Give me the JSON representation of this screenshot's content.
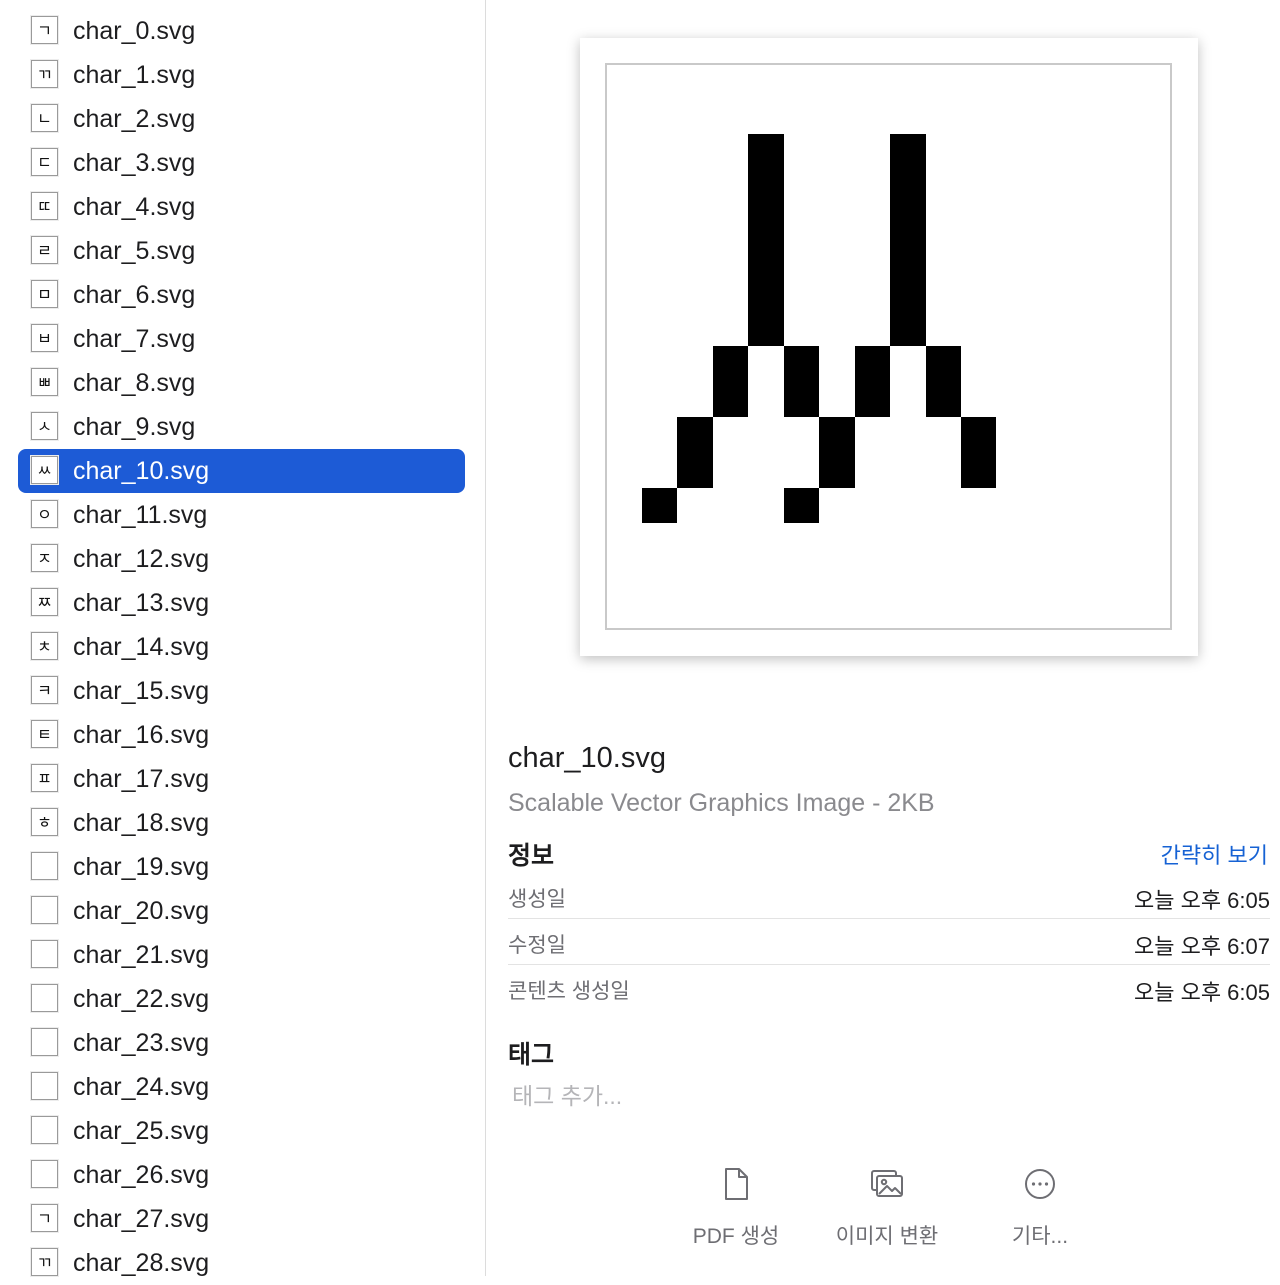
{
  "file_list": [
    {
      "name": "char_0.svg",
      "glyph": "ㄱ"
    },
    {
      "name": "char_1.svg",
      "glyph": "ㄲ"
    },
    {
      "name": "char_2.svg",
      "glyph": "ㄴ"
    },
    {
      "name": "char_3.svg",
      "glyph": "ㄷ"
    },
    {
      "name": "char_4.svg",
      "glyph": "ㄸ"
    },
    {
      "name": "char_5.svg",
      "glyph": "ㄹ"
    },
    {
      "name": "char_6.svg",
      "glyph": "ㅁ"
    },
    {
      "name": "char_7.svg",
      "glyph": "ㅂ"
    },
    {
      "name": "char_8.svg",
      "glyph": "ㅃ"
    },
    {
      "name": "char_9.svg",
      "glyph": "ㅅ"
    },
    {
      "name": "char_10.svg",
      "glyph": "ㅆ",
      "selected": true
    },
    {
      "name": "char_11.svg",
      "glyph": "ㅇ"
    },
    {
      "name": "char_12.svg",
      "glyph": "ㅈ"
    },
    {
      "name": "char_13.svg",
      "glyph": "ㅉ"
    },
    {
      "name": "char_14.svg",
      "glyph": "ㅊ"
    },
    {
      "name": "char_15.svg",
      "glyph": "ㅋ"
    },
    {
      "name": "char_16.svg",
      "glyph": "ㅌ"
    },
    {
      "name": "char_17.svg",
      "glyph": "ㅍ"
    },
    {
      "name": "char_18.svg",
      "glyph": "ㅎ"
    },
    {
      "name": "char_19.svg",
      "glyph": ""
    },
    {
      "name": "char_20.svg",
      "glyph": ""
    },
    {
      "name": "char_21.svg",
      "glyph": ""
    },
    {
      "name": "char_22.svg",
      "glyph": ""
    },
    {
      "name": "char_23.svg",
      "glyph": ""
    },
    {
      "name": "char_24.svg",
      "glyph": ""
    },
    {
      "name": "char_25.svg",
      "glyph": ""
    },
    {
      "name": "char_26.svg",
      "glyph": ""
    },
    {
      "name": "char_27.svg",
      "glyph": "ㄱ"
    },
    {
      "name": "char_28.svg",
      "glyph": "ㄲ"
    }
  ],
  "preview": {
    "glyph": "ㅆ"
  },
  "details": {
    "title": "char_10.svg",
    "subtitle": "Scalable Vector Graphics Image - 2KB",
    "info_heading": "정보",
    "info_toggle": "간략히 보기",
    "rows": [
      {
        "label": "생성일",
        "value": "오늘 오후 6:05"
      },
      {
        "label": "수정일",
        "value": "오늘 오후 6:07"
      },
      {
        "label": "콘텐츠 생성일",
        "value": "오늘 오후 6:05"
      }
    ],
    "tags_heading": "태그",
    "tags_placeholder": "태그 추가..."
  },
  "actions": [
    {
      "label": "PDF 생성",
      "icon": "document-icon"
    },
    {
      "label": "이미지 변환",
      "icon": "photos-icon"
    },
    {
      "label": "기타...",
      "icon": "more-icon"
    }
  ]
}
